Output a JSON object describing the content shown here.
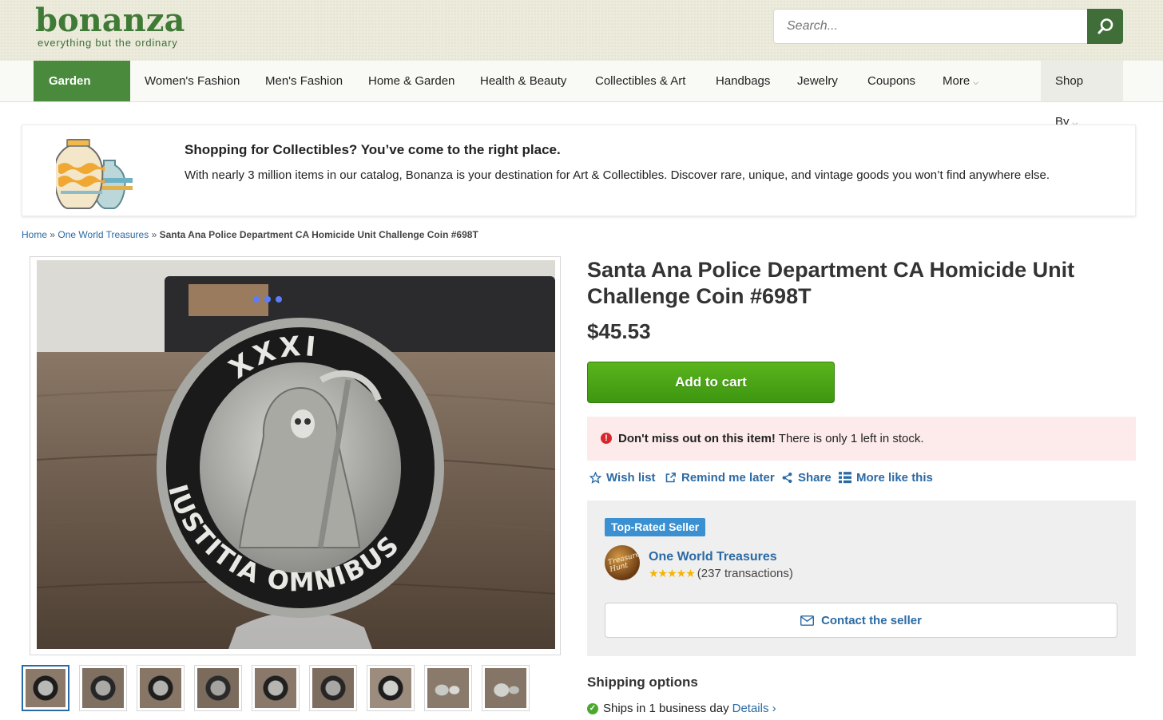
{
  "header": {
    "logo_word": "bonanza",
    "logo_tagline": "everything but the ordinary",
    "search_placeholder": "Search..."
  },
  "nav": {
    "items": [
      {
        "label": "Garden Shop"
      },
      {
        "label": "Women's Fashion"
      },
      {
        "label": "Men's Fashion"
      },
      {
        "label": "Home & Garden"
      },
      {
        "label": "Health & Beauty"
      },
      {
        "label": "Collectibles & Art"
      },
      {
        "label": "Handbags"
      },
      {
        "label": "Jewelry"
      },
      {
        "label": "Coupons"
      },
      {
        "label": "More"
      }
    ],
    "shop_by": "Shop By"
  },
  "promo": {
    "title": "Shopping for Collectibles? You’ve come to the right place.",
    "text": "With nearly 3 million items in our catalog, Bonanza is your destination for Art & Collectibles. Discover rare, unique, and vintage goods you won’t find anywhere else."
  },
  "breadcrumb": {
    "home": "Home",
    "sep": "»",
    "store": "One World Treasures",
    "current": "Santa Ana Police Department CA Homicide Unit Challenge Coin #698T"
  },
  "coin": {
    "top_text": "XXXI",
    "bottom_text": "IUSTITIA OMNIBUS"
  },
  "product": {
    "title": "Santa Ana Police Department CA Homicide Unit Challenge Coin #698T",
    "price": "$45.53",
    "add_to_cart": "Add to cart"
  },
  "alert": {
    "bold": "Don't miss out on this item!",
    "text": " There is only 1 left in stock."
  },
  "actions": {
    "wishlist": "Wish list",
    "remind": "Remind me later",
    "share": "Share",
    "more_like": "More like this"
  },
  "seller": {
    "badge": "Top-Rated Seller",
    "avatar_text": "Treasure Hunt",
    "name": "One World Treasures",
    "rating": 5,
    "transactions": "(237 transactions)",
    "contact": "Contact the seller"
  },
  "shipping": {
    "title": "Shipping options",
    "line": "Ships in 1 business day",
    "details": "Details ›"
  },
  "colors": {
    "brand_green": "#3f6e38",
    "link_blue": "#2b6aa4",
    "cart_green": "#4aa616",
    "alert_bg": "#fdeaea",
    "badge_blue": "#3a90d0"
  }
}
